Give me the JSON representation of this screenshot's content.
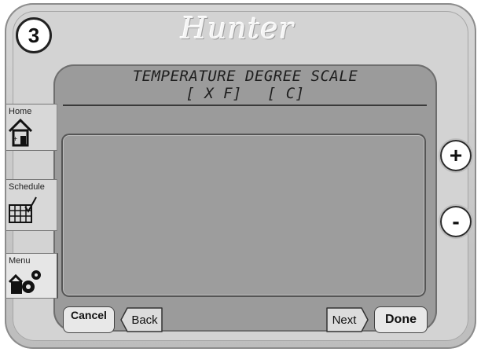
{
  "badge": {
    "step": "3"
  },
  "brand": {
    "name": "Hunter"
  },
  "screen": {
    "title": "TEMPERATURE DEGREE SCALE",
    "options": {
      "fahrenheit": "[ X F]",
      "celsius": "[ C]"
    }
  },
  "tabs": [
    {
      "label": "Home",
      "icon": "home-icon"
    },
    {
      "label": "Schedule",
      "icon": "schedule-icon"
    },
    {
      "label": "Menu",
      "icon": "gears-icon"
    }
  ],
  "side_buttons": {
    "plus": "+",
    "minus": "-"
  },
  "footer": {
    "cancel": "Cancel",
    "back": "Back",
    "next": "Next",
    "done": "Done"
  },
  "colors": {
    "screen": "#9b9b9b",
    "frame": "#d3d3d3"
  }
}
